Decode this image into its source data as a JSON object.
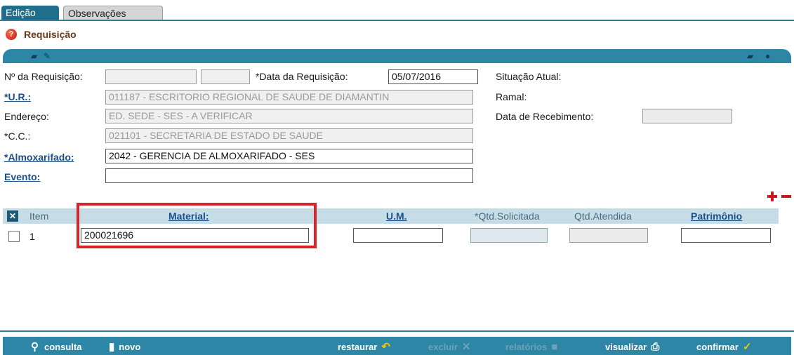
{
  "tabs": [
    {
      "label": "Edição",
      "active": true
    },
    {
      "label": "Observações",
      "active": false
    }
  ],
  "page": {
    "title": "Requisição"
  },
  "form": {
    "n_requisicao_label": "Nº da Requisição:",
    "n_requisicao_value_1": "",
    "n_requisicao_value_2": "",
    "data_requisicao_label": "*Data da Requisição:",
    "data_requisicao_value": "05/07/2016",
    "situacao_label": "Situação Atual:",
    "ur_label": "*U.R.:",
    "ur_value": "011187 - ESCRITORIO REGIONAL DE SAUDE DE DIAMANTIN",
    "ramal_label": "Ramal:",
    "endereco_label": "Endereço:",
    "endereco_value": "ED. SEDE - SES - A VERIFICAR",
    "data_recebimento_label": "Data de Recebimento:",
    "data_recebimento_value": "",
    "cc_label": "*C.C.:",
    "cc_value": "021101 - SECRETARIA DE ESTADO DE SAUDE",
    "almoxarifado_label": "*Almoxarifado:",
    "almoxarifado_value": "2042 - GERENCIA DE ALMOXARIFADO - SES",
    "evento_label": "Evento:",
    "evento_value": ""
  },
  "grid": {
    "headers": {
      "item": "Item",
      "material": "Material:",
      "um": "U.M.",
      "qtd_solicitada": "*Qtd.Solicitada",
      "qtd_atendida": "Qtd.Atendida",
      "patrimonio": "Patrimônio"
    },
    "rows": [
      {
        "item": "1",
        "material": "200021696",
        "um": "",
        "qtd_solicitada": "",
        "qtd_atendida": "",
        "patrimonio": ""
      }
    ]
  },
  "toolbar": {
    "consulta": "consulta",
    "novo": "novo",
    "restaurar": "restaurar",
    "excluir": "excluir",
    "relatorios": "relatórios",
    "visualizar": "visualizar",
    "confirmar": "confirmar"
  },
  "colors": {
    "bar": "#2e86a6",
    "tab_active": "#1f6f8b",
    "highlight_frame": "#d8232a",
    "link": "#1a4f8a"
  }
}
